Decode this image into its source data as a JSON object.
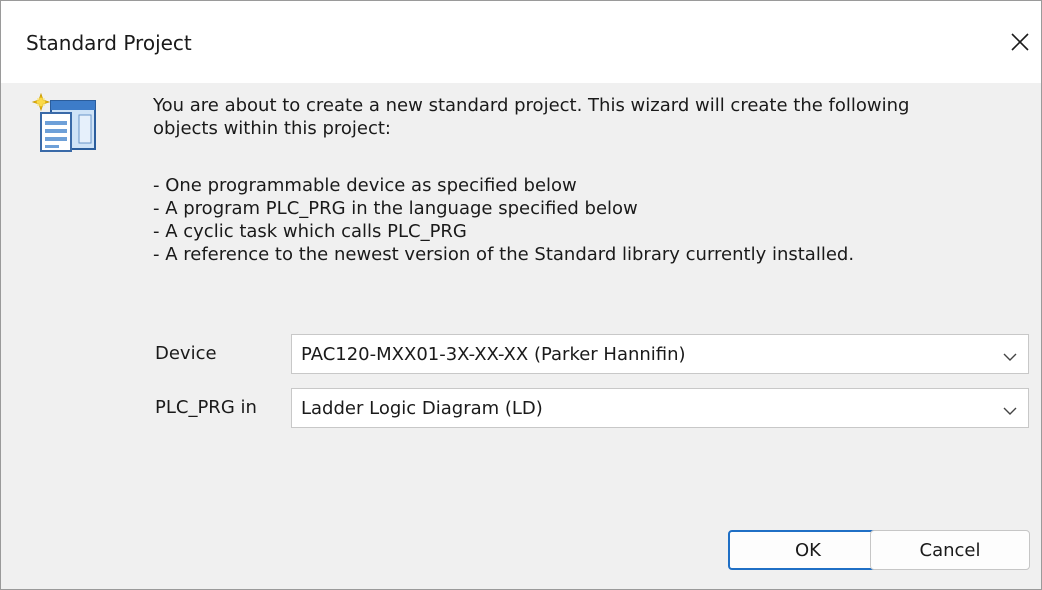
{
  "dialog": {
    "title": "Standard Project",
    "intro": "You are about to create a new standard project. This wizard will create the following\nobjects within this project:",
    "bullets": [
      "- One programmable device as specified below",
      "- A program PLC_PRG in the language specified below",
      "- A cyclic task which calls PLC_PRG",
      "- A reference to the newest version of the Standard library currently installed."
    ]
  },
  "fields": {
    "device": {
      "label": "Device",
      "value": "PAC120-MXX01-3X-XX-XX (Parker Hannifin)"
    },
    "language": {
      "label": "PLC_PRG in",
      "value": "Ladder Logic Diagram (LD)"
    }
  },
  "buttons": {
    "ok": "OK",
    "cancel": "Cancel"
  },
  "icons": {
    "close": "close-icon",
    "wizard": "new-project-wizard-icon",
    "dropdown": "chevron-down-icon"
  },
  "colors": {
    "accent": "#1f6fc5",
    "titlebar": "#ffffff",
    "body": "#f0f0f0"
  }
}
